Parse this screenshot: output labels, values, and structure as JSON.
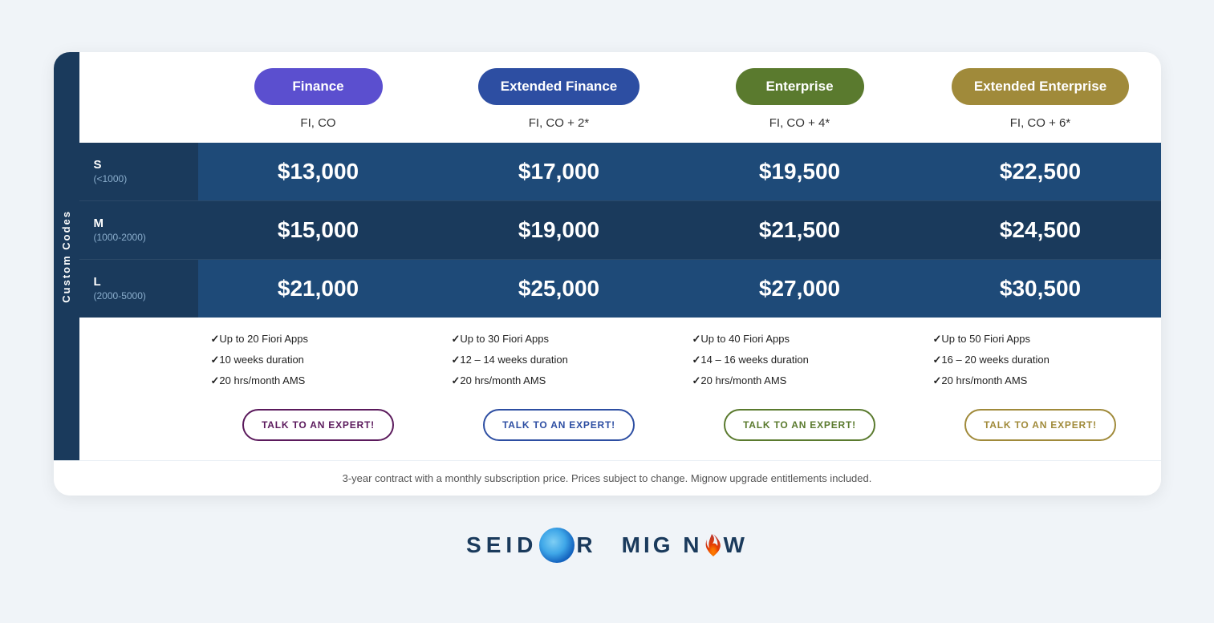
{
  "plans": [
    {
      "id": "finance",
      "label": "Finance",
      "pillColor": "#5b4fcf",
      "subtitle": "FI, CO",
      "prices": {
        "s": "$13,000",
        "m": "$15,000",
        "l": "$21,000"
      },
      "features": [
        "Up to 20 Fiori Apps",
        "10 weeks duration",
        "20 hrs/month AMS"
      ],
      "btnLabel": "TALK TO AN EXPERT!",
      "btnColor": "#5b1a5c"
    },
    {
      "id": "extended-finance",
      "label": "Extended Finance",
      "pillColor": "#2d4ea2",
      "subtitle": "FI, CO + 2*",
      "prices": {
        "s": "$17,000",
        "m": "$19,000",
        "l": "$25,000"
      },
      "features": [
        "Up to 30 Fiori Apps",
        "12 – 14 weeks duration",
        "20 hrs/month AMS"
      ],
      "btnLabel": "TALK TO AN EXPERT!",
      "btnColor": "#2d4ea2"
    },
    {
      "id": "enterprise",
      "label": "Enterprise",
      "pillColor": "#5a7a2e",
      "subtitle": "FI, CO + 4*",
      "prices": {
        "s": "$19,500",
        "m": "$21,500",
        "l": "$27,000"
      },
      "features": [
        "Up to 40 Fiori Apps",
        "14 – 16 weeks duration",
        "20 hrs/month AMS"
      ],
      "btnLabel": "TALK TO AN EXPERT!",
      "btnColor": "#5a7a2e"
    },
    {
      "id": "extended-enterprise",
      "label": "Extended Enterprise",
      "pillColor": "#a08a3a",
      "subtitle": "FI, CO + 6*",
      "prices": {
        "s": "$22,500",
        "m": "$24,500",
        "l": "$30,500"
      },
      "features": [
        "Up to 50 Fiori Apps",
        "16 – 20 weeks duration",
        "20 hrs/month AMS"
      ],
      "btnLabel": "TALK TO AN EXPERT!",
      "btnColor": "#a08a3a"
    }
  ],
  "rows": [
    {
      "size": "S",
      "range": "(<1000)",
      "key": "s"
    },
    {
      "size": "M",
      "range": "(1000-2000)",
      "key": "m"
    },
    {
      "size": "L",
      "range": "(2000-5000)",
      "key": "l"
    }
  ],
  "sideLabel": "Custom Codes",
  "disclaimer": "3-year contract with a monthly subscription price. Prices subject to change. Mignow upgrade entitlements included.",
  "logos": {
    "seidor": "SEID",
    "seidorOrb": "O",
    "seidorEnd": "R",
    "mignow": "MIG N",
    "mignowFlame": "🔥",
    "mignowEnd": "W"
  }
}
